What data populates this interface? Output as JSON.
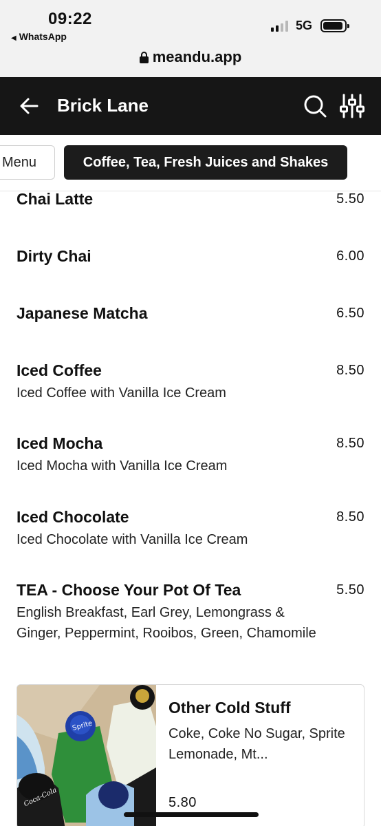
{
  "status_bar": {
    "time": "09:22",
    "back_app": "WhatsApp",
    "network": "5G"
  },
  "browser": {
    "url": "meandu.app"
  },
  "header": {
    "title": "Brick Lane",
    "bg_color": "#161616"
  },
  "tabs": {
    "previous_label": "Menu",
    "active_label": "Coffee, Tea, Fresh Juices and Shakes"
  },
  "items": [
    {
      "name": "Chai Latte",
      "price": "5.50",
      "description": ""
    },
    {
      "name": "Dirty Chai",
      "price": "6.00",
      "description": ""
    },
    {
      "name": "Japanese Matcha",
      "price": "6.50",
      "description": ""
    },
    {
      "name": "Iced Coffee",
      "price": "8.50",
      "description": "Iced Coffee with Vanilla Ice Cream"
    },
    {
      "name": "Iced Mocha",
      "price": "8.50",
      "description": "Iced Mocha with Vanilla Ice Cream"
    },
    {
      "name": "Iced Chocolate",
      "price": "8.50",
      "description": "Iced Chocolate with Vanilla Ice Cream"
    },
    {
      "name": "TEA - Choose Your Pot Of Tea",
      "price": "5.50",
      "description": "English Breakfast, Earl Grey, Lemongrass & Ginger, Peppermint, Rooibos, Green, Chamomile"
    }
  ],
  "card": {
    "title": "Other Cold Stuff",
    "description": "Coke, Coke No Sugar, Sprite Lemonade, Mt...",
    "price": "5.80",
    "image_brand_1": "Sprite",
    "image_brand_2": "Coca-Cola"
  }
}
